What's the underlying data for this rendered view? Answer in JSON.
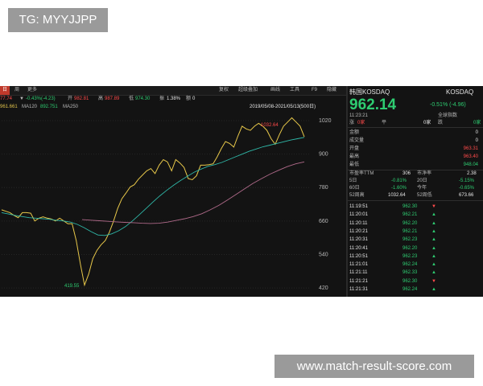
{
  "watermark_top": "TG: MYYJJPP",
  "watermark_bottom": "www.match-result-score.com",
  "toolbar": {
    "day": "日",
    "week": "周",
    "more": "更多",
    "restore": "复权",
    "overlay": "超级叠加",
    "draw": "画线",
    "tools": "工具",
    "f9": "F9",
    "hide": "隐藏"
  },
  "quote_row": {
    "last": "77.74",
    "change": "-0.43%(-4.23)",
    "open_label": "开",
    "open": "982.81",
    "high_label": "高",
    "high": "987.89",
    "low_label": "低",
    "low": "974.30",
    "amp_label": "振",
    "amp": "1.38%",
    "amt_label": "额",
    "amt": "0"
  },
  "ma_row": {
    "ma_a": "961.661",
    "ma120_label": "MA120",
    "ma120": "892.751",
    "ma250_label": "MA250"
  },
  "range_label": "2019/05/08-2021/05/13(500日)",
  "axis_labels": [
    "1020",
    "900",
    "780",
    "660",
    "540",
    "420"
  ],
  "annotation_high": "1032.64",
  "annotation_low": "419.55",
  "side": {
    "name": "韩国KOSDAQ",
    "code": "KOSDAQ",
    "price": "962.14",
    "change": "-0.51% (-4.96)",
    "time": "11:23:21",
    "index_label": "全球指数",
    "rise": "涨",
    "rise_val": "0家",
    "flat": "平",
    "flat_val": "0家",
    "fall": "跌",
    "fall_val": "0家",
    "stats": [
      {
        "label": "金额",
        "value": "0"
      },
      {
        "label": "成交量",
        "value": "0"
      },
      {
        "label": "开盘",
        "value": "963.31"
      },
      {
        "label": "最高",
        "value": "963.40"
      },
      {
        "label": "最低",
        "value": "948.04"
      }
    ],
    "pe_label": "市盈率TTM",
    "pe": "306",
    "pb_label": "市净率",
    "pb": "2.38",
    "d5_label": "5日",
    "d5": "-0.81%",
    "d20_label": "20日",
    "d20": "-5.15%",
    "d60_label": "60日",
    "d60": "-1.60%",
    "ytd_label": "今年",
    "ytd": "-0.65%",
    "h52_label": "52周高",
    "h52": "1032.64",
    "l52_label": "52周低",
    "l52": "673.66",
    "ticks": [
      {
        "time": "11:19:51",
        "price": "962.30",
        "dir": "down"
      },
      {
        "time": "11:20:01",
        "price": "962.21",
        "dir": "up"
      },
      {
        "time": "11:20:11",
        "price": "962.20",
        "dir": "up"
      },
      {
        "time": "11:20:21",
        "price": "962.21",
        "dir": "up"
      },
      {
        "time": "11:20:31",
        "price": "962.23",
        "dir": "up"
      },
      {
        "time": "11:20:41",
        "price": "962.20",
        "dir": "up"
      },
      {
        "time": "11:20:51",
        "price": "962.23",
        "dir": "up"
      },
      {
        "time": "11:21:01",
        "price": "962.24",
        "dir": "up"
      },
      {
        "time": "11:21:11",
        "price": "962.33",
        "dir": "up"
      },
      {
        "time": "11:21:21",
        "price": "962.30",
        "dir": "down"
      },
      {
        "time": "11:21:31",
        "price": "962.24",
        "dir": "up"
      }
    ]
  },
  "colors": {
    "background": "#131313",
    "up": "#ff4b4b",
    "down": "#2ecc71",
    "accent": "#e0c34b"
  },
  "chart_data": {
    "type": "line",
    "title": "",
    "xlabel": "",
    "ylabel": "",
    "ylim": [
      400,
      1040
    ],
    "x_range": [
      "2019/05/08",
      "2021/05/13"
    ],
    "series": [
      {
        "name": "",
        "values": [
          700,
          695,
          690,
          680,
          672,
          690,
          690,
          688,
          660,
          670,
          675,
          670,
          667,
          660,
          670,
          660,
          650,
          650,
          590,
          505,
          430,
          470,
          525,
          555,
          575,
          590,
          620,
          660,
          705,
          740,
          760,
          782,
          790,
          810,
          825,
          840,
          848,
          830,
          860,
          880,
          872,
          840,
          880,
          868,
          852,
          812,
          808,
          822,
          860,
          860,
          862,
          865,
          890,
          920,
          945,
          938,
          925,
          965,
          1000,
          990,
          985,
          1000,
          1010,
          1000,
          985,
          955,
          935,
          970,
          1000,
          1015,
          1030,
          1015,
          1000,
          962
        ]
      },
      {
        "name": "MA120",
        "values": [
          690,
          685,
          680,
          676,
          672,
          670,
          668,
          666,
          662,
          660,
          656,
          648,
          636,
          622,
          610,
          608,
          614,
          625,
          640,
          660,
          682,
          705,
          728,
          750,
          770,
          788,
          805,
          820,
          835,
          846,
          856,
          862,
          870,
          880,
          890,
          900,
          910,
          918,
          926,
          932,
          938,
          944,
          950,
          955,
          960
        ]
      },
      {
        "name": "MA250",
        "values": [
          665,
          663,
          661,
          659,
          657,
          655,
          654,
          652,
          651,
          652,
          656,
          662,
          668,
          676,
          686,
          700,
          716,
          735,
          755,
          775,
          795,
          812,
          828,
          842,
          855,
          865,
          872
        ]
      }
    ]
  }
}
